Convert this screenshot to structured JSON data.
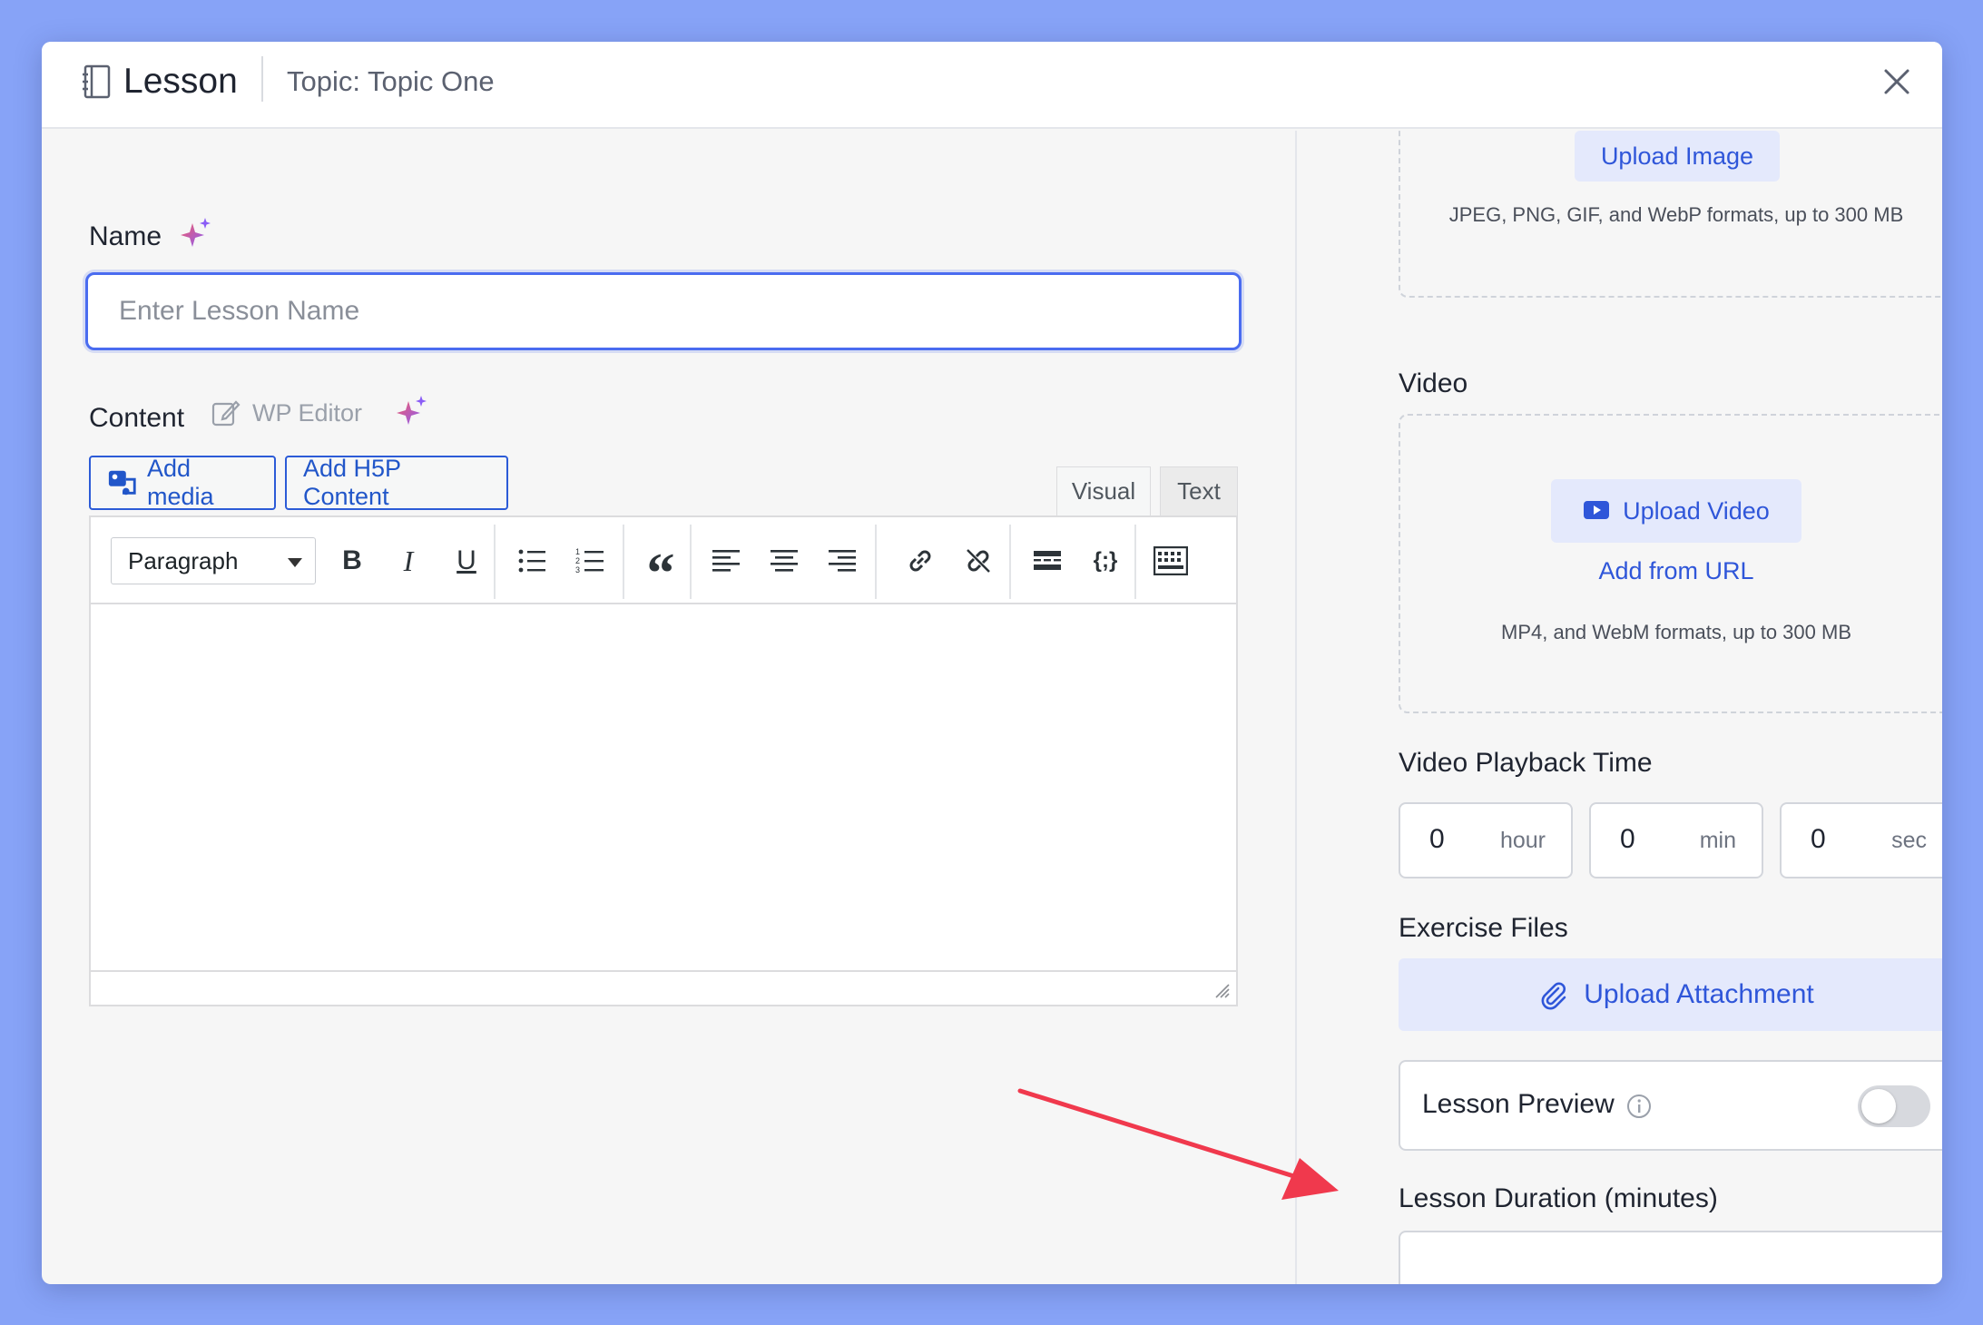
{
  "header": {
    "title": "Lesson",
    "topic": "Topic: Topic One"
  },
  "name_field": {
    "label": "Name",
    "placeholder": "Enter Lesson Name",
    "value": ""
  },
  "content": {
    "label": "Content",
    "wp_editor_label": "WP Editor",
    "add_media_label": "Add media",
    "add_h5p_label": "Add H5P Content",
    "tabs": [
      {
        "label": "Visual",
        "active": true
      },
      {
        "label": "Text",
        "active": false
      }
    ],
    "format_select": "Paragraph",
    "toolbar_icons": [
      "bold-icon",
      "italic-icon",
      "underline-icon",
      "bullet-list-icon",
      "numbered-list-icon",
      "blockquote-icon",
      "align-left-icon",
      "align-center-icon",
      "align-right-icon",
      "link-icon",
      "unlink-icon",
      "read-more-icon",
      "shortcode-icon",
      "toolbar-toggle-icon"
    ],
    "bold_glyph": "B",
    "italic_glyph": "I",
    "underline_glyph": "U",
    "quote_glyph": "“",
    "shortcode_glyph": "{;}"
  },
  "featured_image": {
    "upload_label": "Upload Image",
    "hint": "JPEG, PNG, GIF, and WebP formats, up to 300 MB"
  },
  "video": {
    "label": "Video",
    "upload_label": "Upload Video",
    "add_from_url": "Add from URL",
    "hint": "MP4, and WebM formats, up to 300 MB"
  },
  "playback": {
    "label": "Video Playback Time",
    "hour_value": "0",
    "hour_unit": "hour",
    "min_value": "0",
    "min_unit": "min",
    "sec_value": "0",
    "sec_unit": "sec"
  },
  "exercise": {
    "label": "Exercise Files",
    "upload_label": "Upload Attachment"
  },
  "preview": {
    "label": "Lesson Preview",
    "enabled": false
  },
  "duration": {
    "label": "Lesson Duration (minutes)",
    "value": ""
  },
  "colors": {
    "background": "#87a3f7",
    "accent": "#2f56d9",
    "annotation_arrow": "#f0394d"
  }
}
